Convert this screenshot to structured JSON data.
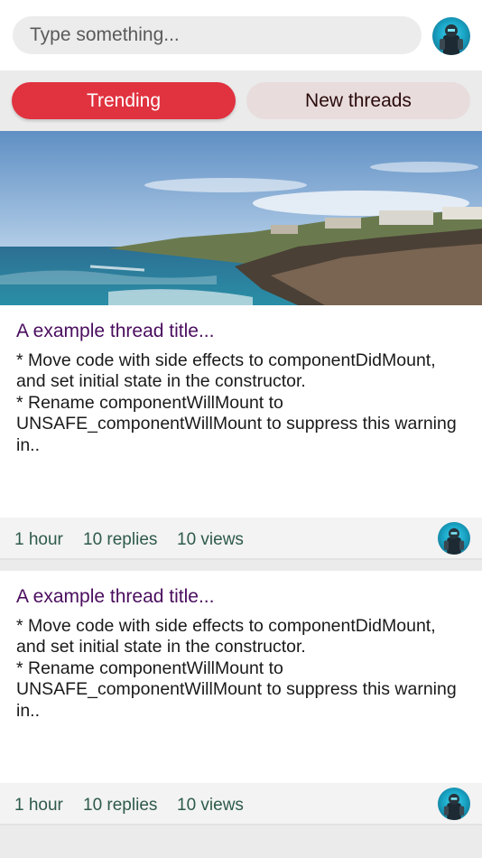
{
  "search": {
    "placeholder": "Type something..."
  },
  "tabs": [
    {
      "label": "Trending",
      "active": true
    },
    {
      "label": "New threads",
      "active": false
    }
  ],
  "colors": {
    "accent": "#e0323f",
    "title": "#4a0d5e",
    "meta": "#2e5a4a"
  },
  "threads": [
    {
      "title": "A example thread title...",
      "body": "* Move code with side effects to componentDidMount, and set initial state in the constructor.\n* Rename componentWillMount to UNSAFE_componentWillMount to suppress this warning in..",
      "time": "1 hour",
      "replies": "10 replies",
      "views": "10 views",
      "has_image": true
    },
    {
      "title": "A example thread title...",
      "body": "* Move code with side effects to componentDidMount, and set initial state in the constructor.\n* Rename componentWillMount to UNSAFE_componentWillMount to suppress this warning in..",
      "time": "1 hour",
      "replies": "10 replies",
      "views": "10 views",
      "has_image": false
    }
  ],
  "icons": {
    "user_avatar": "avatar-icon"
  }
}
